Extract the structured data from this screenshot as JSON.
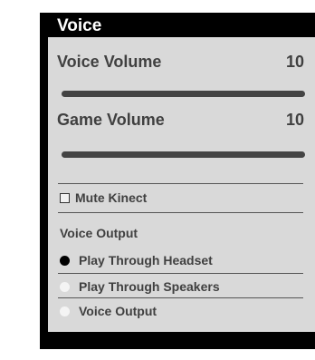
{
  "panel": {
    "title": "Voice"
  },
  "sliders": [
    {
      "label": "Voice Volume",
      "value": "10",
      "level": 1.0
    },
    {
      "label": "Game Volume",
      "value": "10",
      "level": 1.0
    }
  ],
  "mute_kinect": {
    "label": "Mute Kinect",
    "checked": false
  },
  "voice_output": {
    "label": "Voice Output",
    "options": [
      {
        "label": "Play Through Headset",
        "selected": true
      },
      {
        "label": "Play Through Speakers",
        "selected": false
      },
      {
        "label": "Voice Output",
        "selected": false
      }
    ]
  },
  "colors": {
    "panel_bg": "#000000",
    "content_bg": "#d9d9d9",
    "text": "#404040",
    "slider_fill": "#444444"
  }
}
